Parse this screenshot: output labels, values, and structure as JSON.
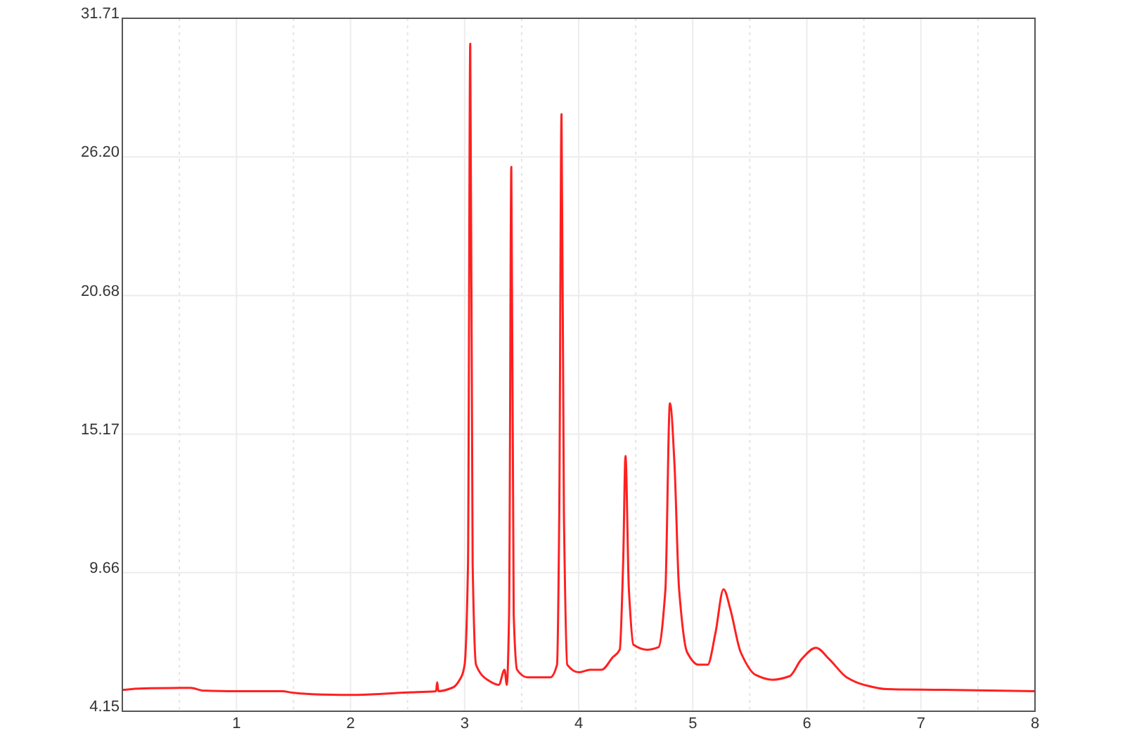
{
  "chart": {
    "chart_data": {
      "type": "line",
      "grid": true,
      "xlim": [
        0,
        8
      ],
      "ylim": [
        4.15,
        31.71
      ],
      "xticks": [
        1,
        2,
        3,
        4,
        5,
        6,
        7,
        8
      ],
      "yticks": [
        {
          "value": 4.15,
          "label": "4.15"
        },
        {
          "value": 9.66,
          "label": "9.66"
        },
        {
          "value": 15.17,
          "label": "15.17"
        },
        {
          "value": 20.68,
          "label": "20.68"
        },
        {
          "value": 26.2,
          "label": "26.20"
        },
        {
          "value": 31.71,
          "label": "31.71"
        }
      ],
      "x": [
        0,
        0.15,
        0.6,
        0.7,
        1.0,
        1.4,
        1.5,
        1.7,
        2.0,
        2.5,
        2.75,
        2.76,
        2.77,
        2.9,
        2.97,
        3.0,
        3.03,
        3.05,
        3.07,
        3.1,
        3.2,
        3.3,
        3.35,
        3.37,
        3.39,
        3.41,
        3.43,
        3.46,
        3.55,
        3.75,
        3.81,
        3.83,
        3.85,
        3.87,
        3.9,
        4.0,
        4.1,
        4.2,
        4.3,
        4.36,
        4.39,
        4.41,
        4.44,
        4.48,
        4.6,
        4.7,
        4.76,
        4.8,
        4.84,
        4.88,
        4.95,
        5.05,
        5.13,
        5.2,
        5.27,
        5.33,
        5.42,
        5.55,
        5.7,
        5.85,
        5.95,
        6.08,
        6.2,
        6.35,
        6.5,
        6.7,
        7.2,
        8.0
      ],
      "series": [
        {
          "color": "#ff2020",
          "values": [
            5.0,
            5.05,
            5.08,
            4.98,
            4.95,
            4.95,
            4.88,
            4.82,
            4.8,
            4.9,
            4.95,
            5.3,
            4.95,
            5.1,
            5.5,
            6.0,
            10.0,
            30.7,
            10.0,
            6.0,
            5.4,
            5.2,
            5.8,
            5.2,
            8.0,
            25.8,
            8.0,
            5.8,
            5.5,
            5.5,
            6.0,
            12.0,
            27.9,
            12.0,
            6.0,
            5.7,
            5.8,
            5.8,
            6.3,
            6.6,
            10.0,
            14.3,
            9.0,
            6.8,
            6.6,
            6.7,
            9.0,
            16.4,
            14.0,
            9.0,
            6.5,
            6.0,
            6.0,
            7.3,
            9.0,
            8.2,
            6.5,
            5.6,
            5.4,
            5.55,
            6.2,
            6.67,
            6.2,
            5.5,
            5.2,
            5.03,
            5.0,
            4.95
          ]
        }
      ]
    }
  }
}
